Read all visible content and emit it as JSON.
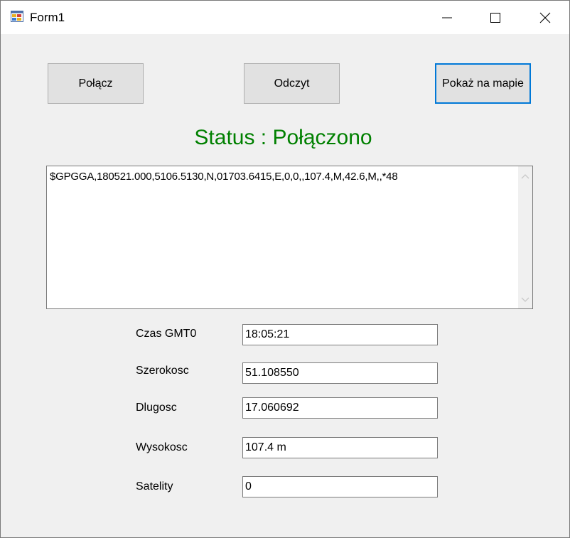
{
  "window": {
    "title": "Form1"
  },
  "toolbar": {
    "connect_label": "Połącz",
    "read_label": "Odczyt",
    "show_map_label": "Pokaż na mapie"
  },
  "status": {
    "text": "Status : Połączono",
    "color": "#008000"
  },
  "nmea_output": "$GPGGA,180521.000,5106.5130,N,01703.6415,E,0,0,,107.4,M,42.6,M,,*48",
  "fields": [
    {
      "label": "Czas GMT0",
      "value": "18:05:21"
    },
    {
      "label": "Szerokosc",
      "value": "51.108550"
    },
    {
      "label": "Dlugosc",
      "value": "17.060692"
    },
    {
      "label": "Wysokosc",
      "value": "107.4 m"
    },
    {
      "label": "Satelity",
      "value": "0"
    }
  ],
  "colors": {
    "focus_border": "#0078d7",
    "button_bg": "#e1e1e1",
    "form_bg": "#f0f0f0"
  }
}
